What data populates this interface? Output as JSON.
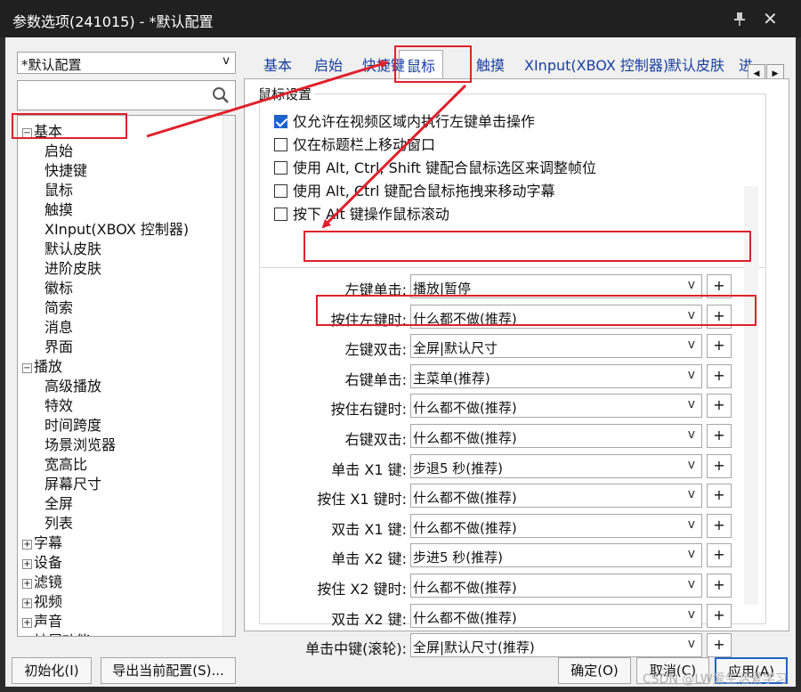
{
  "window": {
    "title": "参数选项(241015) - *默认配置"
  },
  "profile": {
    "value": "*默认配置"
  },
  "tree": [
    {
      "label": "基本",
      "exp": "−",
      "level": 0
    },
    {
      "label": "启始",
      "level": 1
    },
    {
      "label": "快捷键",
      "level": 1
    },
    {
      "label": "鼠标",
      "level": 1
    },
    {
      "label": "触摸",
      "level": 1
    },
    {
      "label": "XInput(XBOX 控制器)",
      "level": 1
    },
    {
      "label": "默认皮肤",
      "level": 1
    },
    {
      "label": "进阶皮肤",
      "level": 1
    },
    {
      "label": "徽标",
      "level": 1
    },
    {
      "label": "简索",
      "level": 1
    },
    {
      "label": "消息",
      "level": 1
    },
    {
      "label": "界面",
      "level": 1
    },
    {
      "label": "播放",
      "exp": "−",
      "level": 0
    },
    {
      "label": "高级播放",
      "level": 1
    },
    {
      "label": "特效",
      "level": 1
    },
    {
      "label": "时间跨度",
      "level": 1
    },
    {
      "label": "场景浏览器",
      "level": 1
    },
    {
      "label": "宽高比",
      "level": 1
    },
    {
      "label": "屏幕尺寸",
      "level": 1
    },
    {
      "label": "全屏",
      "level": 1
    },
    {
      "label": "列表",
      "level": 1
    },
    {
      "label": "字幕",
      "exp": "+",
      "level": 0
    },
    {
      "label": "设备",
      "exp": "+",
      "level": 0
    },
    {
      "label": "滤镜",
      "exp": "+",
      "level": 0
    },
    {
      "label": "视频",
      "exp": "+",
      "level": 0
    },
    {
      "label": "声音",
      "exp": "+",
      "level": 0
    },
    {
      "label": "扩展功能",
      "exp": "+",
      "level": 0
    }
  ],
  "tabs": [
    "基本",
    "启始",
    "快捷键",
    "鼠标",
    "触摸",
    "XInput(XBOX 控制器)",
    "默认皮肤",
    "进"
  ],
  "active_tab": "鼠标",
  "group_title": "鼠标设置",
  "checkboxes": [
    {
      "label": "仅允许在视频区域内执行左键单击操作",
      "checked": true
    },
    {
      "label": "仅在标题栏上移动窗口",
      "checked": false
    },
    {
      "label": "使用 Alt, Ctrl, Shift 键配合鼠标选区来调整帧位",
      "checked": false
    },
    {
      "label": "使用 Alt, Ctrl 键配合鼠标拖拽来移动字幕",
      "checked": false
    },
    {
      "label": "按下 Alt 键操作鼠标滚动",
      "checked": false
    }
  ],
  "actions": [
    {
      "label": "左键单击:",
      "value": "播放|暂停"
    },
    {
      "label": "按住左键时:",
      "value": "什么都不做(推荐)"
    },
    {
      "label": "左键双击:",
      "value": "全屏|默认尺寸"
    },
    {
      "label": "右键单击:",
      "value": "主菜单(推荐)"
    },
    {
      "label": "按住右键时:",
      "value": "什么都不做(推荐)"
    },
    {
      "label": "右键双击:",
      "value": "什么都不做(推荐)"
    },
    {
      "label": "单击 X1 键:",
      "value": "步退5 秒(推荐)"
    },
    {
      "label": "按住 X1 键时:",
      "value": "什么都不做(推荐)"
    },
    {
      "label": "双击 X1 键:",
      "value": "什么都不做(推荐)"
    },
    {
      "label": "单击 X2 键:",
      "value": "步进5 秒(推荐)"
    },
    {
      "label": "按住 X2 键时:",
      "value": "什么都不做(推荐)"
    },
    {
      "label": "双击 X2 键:",
      "value": "什么都不做(推荐)"
    },
    {
      "label": "单击中键(滚轮):",
      "value": "全屏|默认尺寸(推荐)"
    }
  ],
  "plus_label": "+",
  "dropdown_arrow": "v",
  "buttons": {
    "init": "初始化(I)",
    "export": "导出当前配置(S)...",
    "ok": "确定(O)",
    "cancel": "取消(C)",
    "apply": "应用(A)"
  },
  "watermark": "CSDN @LW爱生活爱学习",
  "colors": {
    "accent": "#1e63c9",
    "highlight": "#e0202c",
    "tab_text": "#1a3fa0"
  }
}
